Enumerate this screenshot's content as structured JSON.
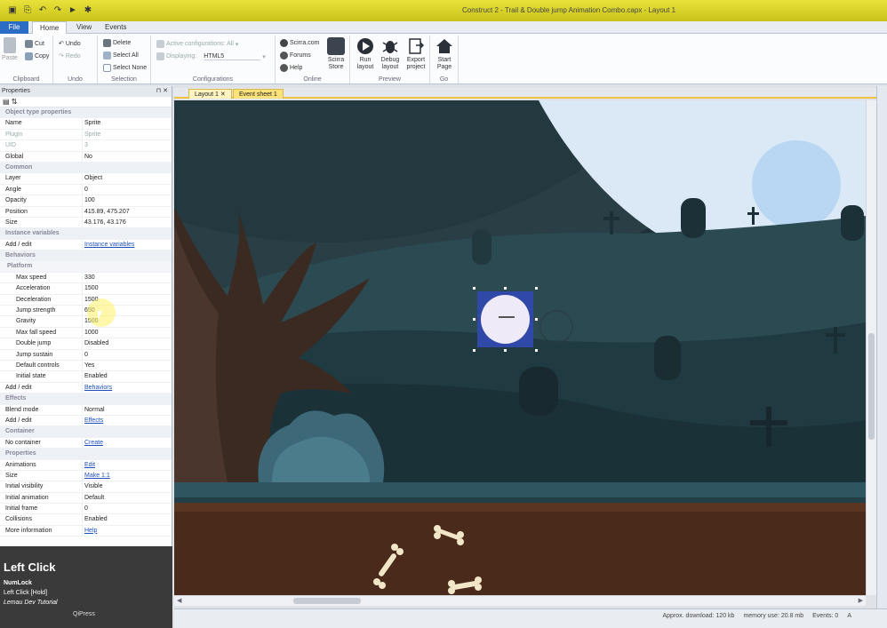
{
  "window": {
    "title": "Construct 2 - Trail & Double jump Animation Combo.capx - Layout 1"
  },
  "ribbon_tabs": [
    "File",
    "Home",
    "View",
    "Events"
  ],
  "ribbon": {
    "clipboard": {
      "paste": "Paste",
      "cut": "Cut",
      "copy": "Copy",
      "label": "Clipboard"
    },
    "undo": {
      "undo": "Undo",
      "redo": "Redo",
      "label": "Undo"
    },
    "selection": {
      "delete": "Delete",
      "select_all": "Select All",
      "select_none": "Select None",
      "label": "Selection"
    },
    "configurations": {
      "active": "Active configurations: All",
      "displaying_label": "Displaying:",
      "displaying_value": "HTML5",
      "label": "Configurations"
    },
    "online": {
      "scirra": "Scirra.com",
      "forums": "Forums",
      "help": "Help",
      "store_line1": "Scirra",
      "store_line2": "Store",
      "label": "Online"
    },
    "preview": {
      "run_line1": "Run",
      "run_line2": "layout",
      "debug_line1": "Debug",
      "debug_line2": "layout",
      "export_line1": "Export",
      "export_line2": "project",
      "label": "Preview"
    },
    "go": {
      "start_line1": "Start",
      "start_line2": "Page",
      "label": "Go"
    }
  },
  "properties": {
    "header": "Properties",
    "rows": [
      {
        "kind": "hdr",
        "key": "Object type properties"
      },
      {
        "kind": "row",
        "key": "Name",
        "value": "Sprite"
      },
      {
        "kind": "dim",
        "key": "Plugin",
        "value": "Sprite"
      },
      {
        "kind": "dim",
        "key": "UID",
        "value": "3"
      },
      {
        "kind": "row",
        "key": "Global",
        "value": "No"
      },
      {
        "kind": "hdr",
        "key": "Common"
      },
      {
        "kind": "row",
        "key": "Layer",
        "value": "Object"
      },
      {
        "kind": "row",
        "key": "Angle",
        "value": "0"
      },
      {
        "kind": "row",
        "key": "Opacity",
        "value": "100"
      },
      {
        "kind": "row",
        "key": "Position",
        "value": "415.89, 475.207"
      },
      {
        "kind": "row",
        "key": "Size",
        "value": "43.176, 43.176"
      },
      {
        "kind": "hdr",
        "key": "Instance variables"
      },
      {
        "kind": "link",
        "key": "Add / edit",
        "value": "Instance variables"
      },
      {
        "kind": "hdr",
        "key": "Behaviors"
      },
      {
        "kind": "subhdr",
        "key": "Platform"
      },
      {
        "kind": "sub",
        "key": "Max speed",
        "value": "330"
      },
      {
        "kind": "sub",
        "key": "Acceleration",
        "value": "1500"
      },
      {
        "kind": "sub",
        "key": "Deceleration",
        "value": "1500"
      },
      {
        "kind": "sub",
        "key": "Jump strength",
        "value": "650"
      },
      {
        "kind": "sub",
        "key": "Gravity",
        "value": "1500"
      },
      {
        "kind": "sub",
        "key": "Max fall speed",
        "value": "1000"
      },
      {
        "kind": "sub",
        "key": "Double jump",
        "value": "Disabled"
      },
      {
        "kind": "sub",
        "key": "Jump sustain",
        "value": "0"
      },
      {
        "kind": "sub",
        "key": "Default controls",
        "value": "Yes"
      },
      {
        "kind": "sub",
        "key": "Initial state",
        "value": "Enabled"
      },
      {
        "kind": "link",
        "key": "Add / edit",
        "value": "Behaviors"
      },
      {
        "kind": "hdr",
        "key": "Effects"
      },
      {
        "kind": "row",
        "key": "Blend mode",
        "value": "Normal"
      },
      {
        "kind": "link",
        "key": "Add / edit",
        "value": "Effects"
      },
      {
        "kind": "hdr",
        "key": "Container"
      },
      {
        "kind": "link",
        "key": "No container",
        "value": "Create"
      },
      {
        "kind": "hdr",
        "key": "Properties"
      },
      {
        "kind": "link",
        "key": "Animations",
        "value": "Edit"
      },
      {
        "kind": "link",
        "key": "Size",
        "value": "Make 1:1"
      },
      {
        "kind": "row",
        "key": "Initial visibility",
        "value": "Visible"
      },
      {
        "kind": "row",
        "key": "Initial animation",
        "value": "Default"
      },
      {
        "kind": "row",
        "key": "Initial frame",
        "value": "0"
      },
      {
        "kind": "row",
        "key": "Collisions",
        "value": "Enabled"
      },
      {
        "kind": "link",
        "key": "More information",
        "value": "Help"
      }
    ]
  },
  "overlay": {
    "big": "Left Click",
    "line2": "NumLock",
    "line3": "Left Click [Hold]",
    "line4": "Lemau Dev Tutorial",
    "line5": "QiPress"
  },
  "doc_tabs": [
    "Layout 1",
    "Event sheet 1"
  ],
  "statusbar": {
    "download": "Approx. download: 120 kb",
    "memory": "memory use: 20.8 mb",
    "events": "Events: 0",
    "layer": "A"
  },
  "colors": {
    "title_bar": "#d8d22a",
    "file_tab": "#2b6cc4",
    "sky_moon": "#dbe9f6",
    "ground_dirt": "#4a2a1a",
    "grass": "#2f5560",
    "sprite_selection": "#3049a8"
  }
}
